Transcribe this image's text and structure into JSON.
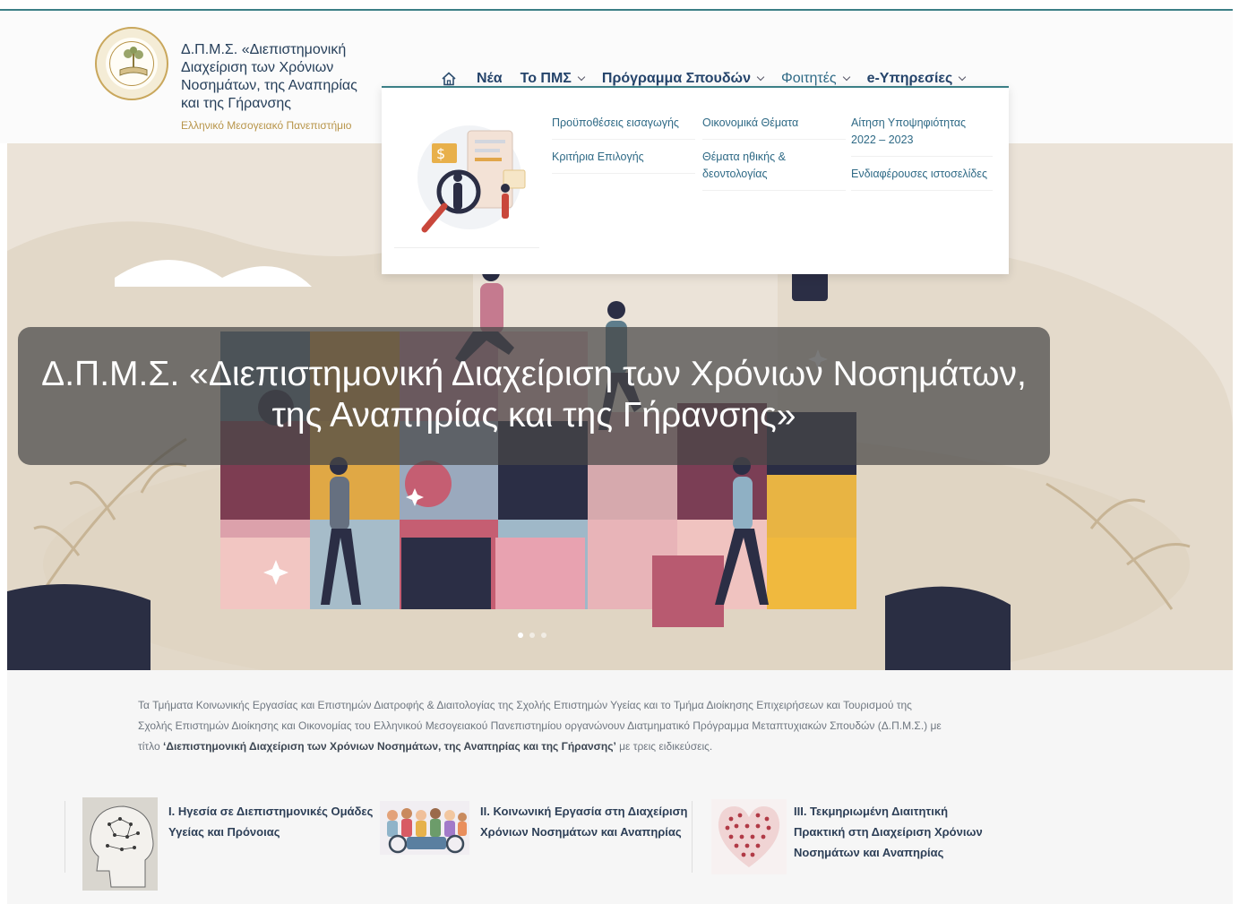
{
  "header": {
    "brand_title": "Δ.Π.Μ.Σ. «Διεπιστημονική Διαχείριση των Χρόνιων Νοσημάτων, της Αναπηρίας και της Γήρανσης",
    "university": "Ελληνικό Μεσογειακό Πανεπιστήμιο",
    "logo_icon": "university-seal-icon"
  },
  "nav": {
    "home_icon": "home-icon",
    "items": [
      {
        "label": "Νέα",
        "dropdown": false
      },
      {
        "label": "Το ΠΜΣ",
        "dropdown": true
      },
      {
        "label": "Πρόγραμμα Σπουδών",
        "dropdown": true
      },
      {
        "label": "Φοιτητές",
        "dropdown": true
      },
      {
        "label": "e-Υπηρεσίες",
        "dropdown": true
      }
    ]
  },
  "dropdown": {
    "col1": [
      "Προϋποθέσεις εισαγωγής",
      "Κριτήρια Επιλογής"
    ],
    "col2": [
      "Οικονομικά Θέματα",
      "Θέματα ηθικής & δεοντολογίας"
    ],
    "col3": [
      "Αίτηση Υποψηφιότητας 2022 – 2023",
      "Ενδιαφέρουσες ιστοσελίδες"
    ]
  },
  "hero": {
    "title_line1": "Δ.Π.Μ.Σ. «Διεπιστημονική Διαχείριση των Χρόνιων Νοσημάτων,",
    "title_line2": "της Αναπηρίας και της Γήρανσης»",
    "slides": 3,
    "active_slide": 1
  },
  "intro": {
    "text": "Τα Τμήματα Κοινωνικής Εργασίας και Επιστημών Διατροφής & Διαιτολογίας της Σχολής Επιστημών Υγείας και το Τμήμα Διοίκησης Επιχειρήσεων και Τουρισμού της Σχολής Επιστημών Διοίκησης και Οικονομίας του Ελληνικού Μεσογειακού Πανεπιστημίου οργανώνουν Διατμηματικό Πρόγραμμα Μεταπτυχιακών Σπουδών (Δ.Π.Μ.Σ.) με τίτλο",
    "bold": "Διεπιστημονική Διαχείριση των Χρόνιων Νοσημάτων, της Αναπηρίας και της Γήρανσης",
    "suffix": "με τρεις ειδικεύσεις."
  },
  "specializations": [
    {
      "title": "I. Ηγεσία σε Διεπιστημονικές Ομάδες Υγείας και Πρόνοιας",
      "icon": "head-brain-icon"
    },
    {
      "title": "II. Κοινωνική Εργασία στη Διαχείριση Χρόνιων Νοσημάτων και Αναπηρίας",
      "icon": "group-people-icon"
    },
    {
      "title": "III. Τεκμηριωμένη Διαιτητική Πρακτική στη Διαχείριση Χρόνιων Νοσημάτων και Αναπηρίας",
      "icon": "heart-people-icon"
    }
  ],
  "colors": {
    "accent": "#3b7f86",
    "nav_text": "#25446b",
    "gold": "#b8954a",
    "hero_bg": "#ebe3d8"
  }
}
